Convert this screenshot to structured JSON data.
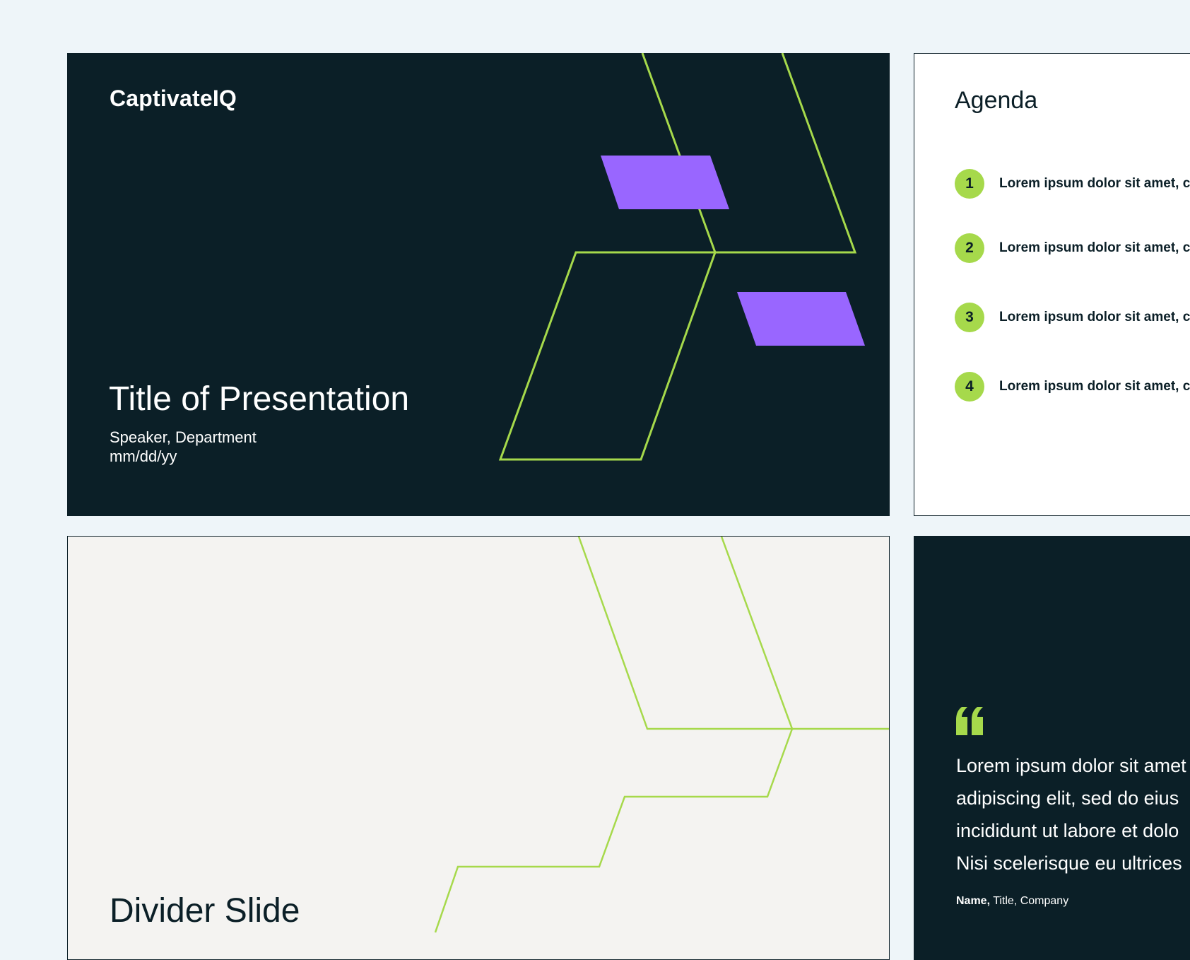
{
  "colors": {
    "background": "#EEF5F9",
    "dark": "#0B1F27",
    "accent_green": "#A6D94B",
    "accent_purple": "#9966FF",
    "light_slide": "#F4F3F1",
    "white": "#FFFFFF"
  },
  "title_slide": {
    "logo": "CaptivateIQ",
    "title": "Title of Presentation",
    "speaker": "Speaker, Department",
    "date": "mm/dd/yy"
  },
  "agenda_slide": {
    "title": "Agenda",
    "items": [
      {
        "number": "1",
        "text": "Lorem ipsum dolor sit amet, c"
      },
      {
        "number": "2",
        "text": "Lorem ipsum dolor sit amet, c"
      },
      {
        "number": "3",
        "text": "Lorem ipsum dolor sit amet, c"
      },
      {
        "number": "4",
        "text": "Lorem ipsum dolor sit amet, c"
      }
    ]
  },
  "divider_slide": {
    "title": "Divider Slide"
  },
  "quote_slide": {
    "quote_mark": "“",
    "lines": [
      "Lorem ipsum dolor sit amet",
      "adipiscing elit, sed do eius",
      "incididunt ut labore et dolo",
      "Nisi scelerisque eu ultrices"
    ],
    "attribution_name": "Name,",
    "attribution_rest": " Title, Company"
  }
}
